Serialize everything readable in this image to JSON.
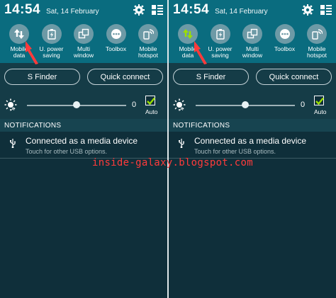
{
  "status_bar": {
    "time": "14:54",
    "date": "Sat, 14 February",
    "icons": [
      "gear-icon",
      "grid-list-icon"
    ]
  },
  "quick_toggles": [
    {
      "label_line1": "Mobile",
      "label_line2": "data",
      "icon": "mobile-data-icon"
    },
    {
      "label_line1": "U. power",
      "label_line2": "saving",
      "icon": "power-saving-icon"
    },
    {
      "label_line1": "Multi",
      "label_line2": "window",
      "icon": "multi-window-icon"
    },
    {
      "label_line1": "Toolbox",
      "label_line2": "",
      "icon": "toolbox-icon"
    },
    {
      "label_line1": "Mobile",
      "label_line2": "hotspot",
      "icon": "hotspot-icon"
    }
  ],
  "buttons": {
    "s_finder": "S Finder",
    "quick_connect": "Quick connect"
  },
  "brightness": {
    "value": "0",
    "level": 0.5,
    "auto_label": "Auto",
    "auto_checked": true
  },
  "notifications": {
    "header": "NOTIFICATIONS",
    "items": [
      {
        "title": "Connected as a media device",
        "subtitle": "Touch for other USB options.",
        "icon": "usb-icon"
      }
    ]
  },
  "watermark": "inside-galaxy.blogspot.com",
  "colors": {
    "accent": "#0a6c7f",
    "panel_bg": "#0f2f3a",
    "toggle_inactive": "#6d9aa6",
    "mobile_data_active": "#9be000",
    "checkmark": "#9be000",
    "annotation": "#ff3b3b"
  },
  "panels": [
    {
      "mobile_data_active": false
    },
    {
      "mobile_data_active": true
    }
  ]
}
